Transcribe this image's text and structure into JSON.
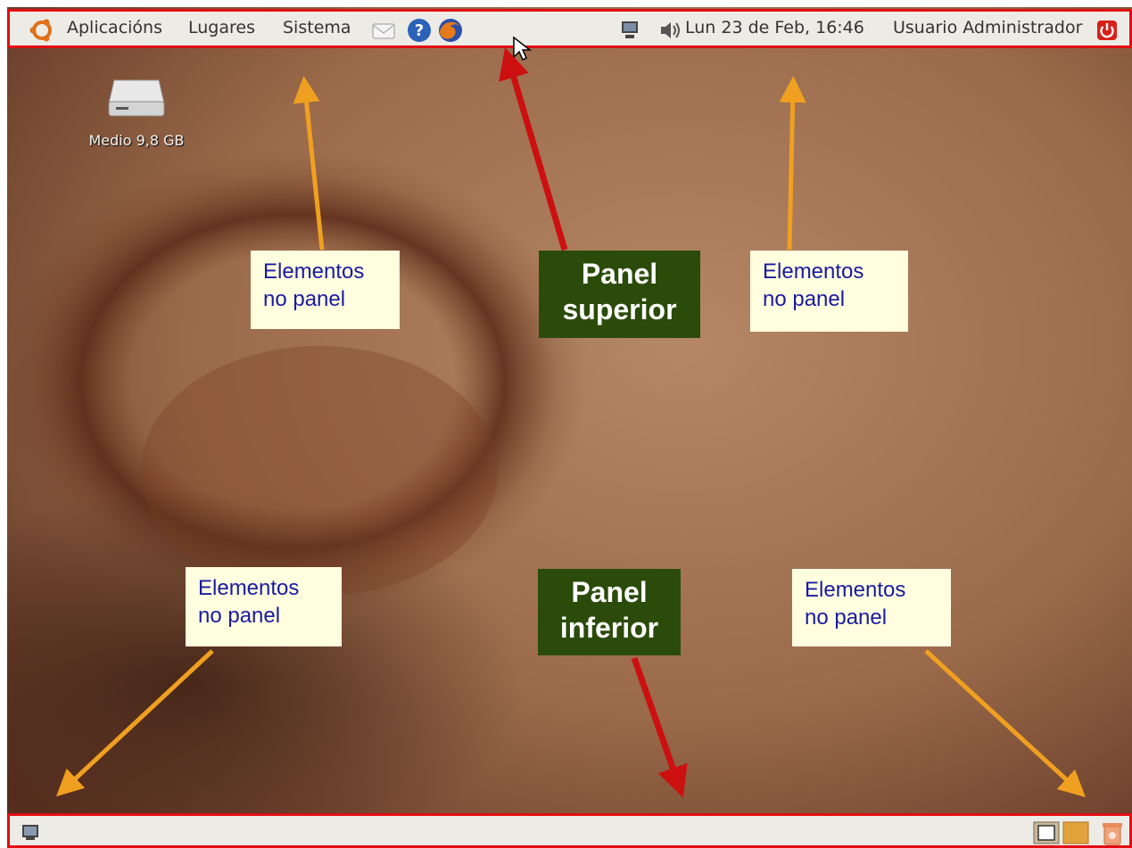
{
  "top_panel": {
    "menus": [
      "Aplicacións",
      "Lugares",
      "Sistema"
    ],
    "clock": "Lun 23 de Feb, 16:46",
    "user": "Usuario Administrador"
  },
  "desktop": {
    "drive_label": "Medio 9,8 GB"
  },
  "annotations": {
    "items_top_left": [
      "Elementos",
      "no panel"
    ],
    "items_top_right": [
      "Elementos",
      "no panel"
    ],
    "items_bottom_left": [
      "Elementos",
      "no panel"
    ],
    "items_bottom_right": [
      "Elementos",
      "no panel"
    ],
    "panel_top": [
      "Panel",
      "superior"
    ],
    "panel_bottom": [
      "Panel",
      "inferior"
    ]
  },
  "colors": {
    "panel_border": "#e30d12",
    "label_bg": "#ffffe0",
    "label_text": "#1a1aa0",
    "panel_label_bg": "#2b4b0a",
    "arrow_orange": "#f0a020",
    "arrow_red": "#cc1010"
  },
  "icons": {
    "top_panel": [
      "ubuntu-logo-icon",
      "mail-icon",
      "help-icon",
      "firefox-icon",
      "network-icon",
      "volume-icon",
      "shutdown-icon"
    ],
    "desktop": [
      "drive-icon"
    ],
    "bottom_panel": [
      "show-desktop-icon",
      "workspace-1-icon",
      "workspace-2-icon",
      "trash-icon"
    ]
  }
}
